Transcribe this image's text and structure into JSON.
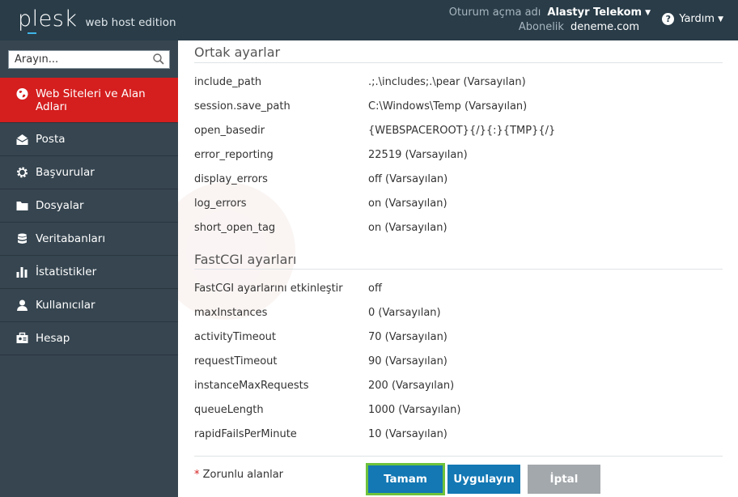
{
  "header": {
    "logo_word": "plesk",
    "logo_edition": "web host edition",
    "login_label": "Oturum açma adı",
    "login_value": "Alastyr Telekom",
    "subscription_label": "Abonelik",
    "subscription_value": "deneme.com",
    "help_label": "Yardım"
  },
  "sidebar": {
    "search_placeholder": "Arayın...",
    "items": [
      {
        "label": "Web Siteleri ve Alan Adları",
        "icon": "globe-icon",
        "active": true
      },
      {
        "label": "Posta",
        "icon": "mail-icon"
      },
      {
        "label": "Başvurular",
        "icon": "gear-icon"
      },
      {
        "label": "Dosyalar",
        "icon": "folder-icon"
      },
      {
        "label": "Veritabanları",
        "icon": "database-icon"
      },
      {
        "label": "İstatistikler",
        "icon": "bar-chart-icon"
      },
      {
        "label": "Kullanıcılar",
        "icon": "user-icon"
      },
      {
        "label": "Hesap",
        "icon": "account-icon"
      }
    ]
  },
  "common": {
    "title": "Ortak ayarlar",
    "rows": [
      {
        "key": "include_path",
        "value": ".;.\\includes;.\\pear (Varsayılan)"
      },
      {
        "key": "session.save_path",
        "value": "C:\\Windows\\Temp (Varsayılan)"
      },
      {
        "key": "open_basedir",
        "value": "{WEBSPACEROOT}{/}{:}{TMP}{/}"
      },
      {
        "key": "error_reporting",
        "value": "22519 (Varsayılan)"
      },
      {
        "key": "display_errors",
        "value": "off (Varsayılan)"
      },
      {
        "key": "log_errors",
        "value": "on (Varsayılan)"
      },
      {
        "key": "short_open_tag",
        "value": "on (Varsayılan)"
      }
    ]
  },
  "fastcgi": {
    "title": "FastCGI ayarları",
    "rows": [
      {
        "key": "FastCGI ayarlarını etkinleştir",
        "value": "off"
      },
      {
        "key": "maxInstances",
        "value": "0 (Varsayılan)"
      },
      {
        "key": "activityTimeout",
        "value": "70 (Varsayılan)"
      },
      {
        "key": "requestTimeout",
        "value": "90 (Varsayılan)"
      },
      {
        "key": "instanceMaxRequests",
        "value": "200 (Varsayılan)"
      },
      {
        "key": "queueLength",
        "value": "1000 (Varsayılan)"
      },
      {
        "key": "rapidFailsPerMinute",
        "value": "10 (Varsayılan)"
      }
    ]
  },
  "footer": {
    "required_star": "*",
    "required_text": "Zorunlu alanlar",
    "ok_label": "Tamam",
    "apply_label": "Uygulayın",
    "cancel_label": "İptal"
  },
  "colors": {
    "header_bg": "#293c48",
    "sidebar_bg": "#364550",
    "active_item": "#d51e1e",
    "primary_button": "#1378b4",
    "focus_outline": "#6fc23b",
    "cancel_button": "#a3a8ac"
  }
}
